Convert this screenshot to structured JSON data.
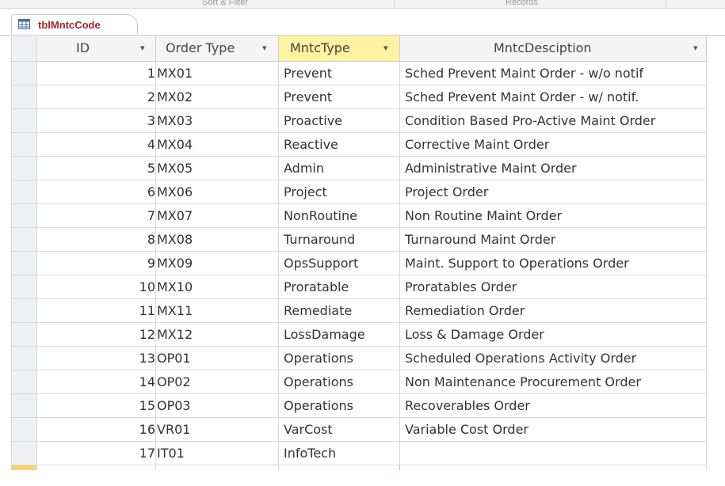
{
  "ribbon": {
    "groups": [
      "Sort & Filter",
      "Records"
    ]
  },
  "document_tab": {
    "label": "tblMntcCode",
    "icon": "table-icon"
  },
  "table": {
    "columns": [
      {
        "label": "ID"
      },
      {
        "label": "Order Type"
      },
      {
        "label": "MntcType"
      },
      {
        "label": "MntcDesciption"
      }
    ],
    "selected_column": "MntcType",
    "rows": [
      {
        "id": "1",
        "order_type": "MX01",
        "mntc_type": "Prevent",
        "description": "Sched Prevent Maint Order  - w/o notif"
      },
      {
        "id": "2",
        "order_type": "MX02",
        "mntc_type": "Prevent",
        "description": "Sched Prevent Maint Order - w/ notif."
      },
      {
        "id": "3",
        "order_type": "MX03",
        "mntc_type": "Proactive",
        "description": "Condition Based Pro-Active Maint Order"
      },
      {
        "id": "4",
        "order_type": "MX04",
        "mntc_type": "Reactive",
        "description": "Corrective Maint Order"
      },
      {
        "id": "5",
        "order_type": "MX05",
        "mntc_type": "Admin",
        "description": "Administrative Maint Order"
      },
      {
        "id": "6",
        "order_type": "MX06",
        "mntc_type": "Project",
        "description": "Project Order"
      },
      {
        "id": "7",
        "order_type": "MX07",
        "mntc_type": "NonRoutine",
        "description": "Non Routine Maint Order"
      },
      {
        "id": "8",
        "order_type": "MX08",
        "mntc_type": "Turnaround",
        "description": "Turnaround Maint Order"
      },
      {
        "id": "9",
        "order_type": "MX09",
        "mntc_type": "OpsSupport",
        "description": "Maint. Support  to Operations Order"
      },
      {
        "id": "10",
        "order_type": "MX10",
        "mntc_type": "Proratable",
        "description": "Proratables Order"
      },
      {
        "id": "11",
        "order_type": "MX11",
        "mntc_type": "Remediate",
        "description": "Remediation Order"
      },
      {
        "id": "12",
        "order_type": "MX12",
        "mntc_type": "LossDamage",
        "description": "Loss & Damage Order"
      },
      {
        "id": "13",
        "order_type": "OP01",
        "mntc_type": "Operations",
        "description": "Scheduled Operations Activity Order"
      },
      {
        "id": "14",
        "order_type": "OP02",
        "mntc_type": "Operations",
        "description": "Non Maintenance Procurement Order"
      },
      {
        "id": "15",
        "order_type": "OP03",
        "mntc_type": "Operations",
        "description": "Recoverables Order"
      },
      {
        "id": "16",
        "order_type": "VR01",
        "mntc_type": "VarCost",
        "description": "Variable Cost Order"
      },
      {
        "id": "17",
        "order_type": "IT01",
        "mntc_type": "InfoTech",
        "description": ""
      }
    ]
  },
  "colors": {
    "tab_label": "#a4262c",
    "selected_header": "#fff2a1",
    "new_record_selector": "#f7d46b"
  }
}
